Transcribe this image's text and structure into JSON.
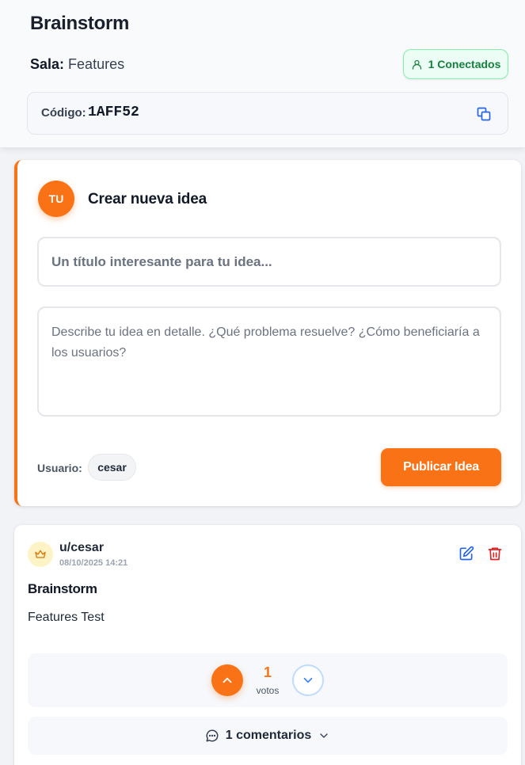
{
  "header": {
    "app_title": "Brainstorm",
    "room_label": "Sala:",
    "room_name": "Features",
    "connected_label": "1 Conectados",
    "code_label": "Código:",
    "code_value": "1AFF52"
  },
  "create": {
    "avatar_text": "TU",
    "title": "Crear nueva idea",
    "title_placeholder": "Un título interesante para tu idea...",
    "desc_placeholder": "Describe tu idea en detalle. ¿Qué problema resuelve? ¿Cómo beneficiaría a los usuarios?",
    "user_label": "Usuario:",
    "user_name": "cesar",
    "publish_label": "Publicar Idea"
  },
  "post": {
    "user": "u/cesar",
    "date": "08/10/2025 14:21",
    "title": "Brainstorm",
    "body": "Features Test",
    "votes": "1",
    "votes_label": "votos",
    "comments_label": "1 comentarios"
  },
  "colors": {
    "accent": "#f97316",
    "connected_green": "#15803d",
    "edit_blue": "#2563eb",
    "delete_red": "#dc2626"
  },
  "icons": [
    "user-icon",
    "copy-icon",
    "crown-icon",
    "edit-icon",
    "trash-icon",
    "chevron-up-icon",
    "chevron-down-icon",
    "comment-icon"
  ]
}
